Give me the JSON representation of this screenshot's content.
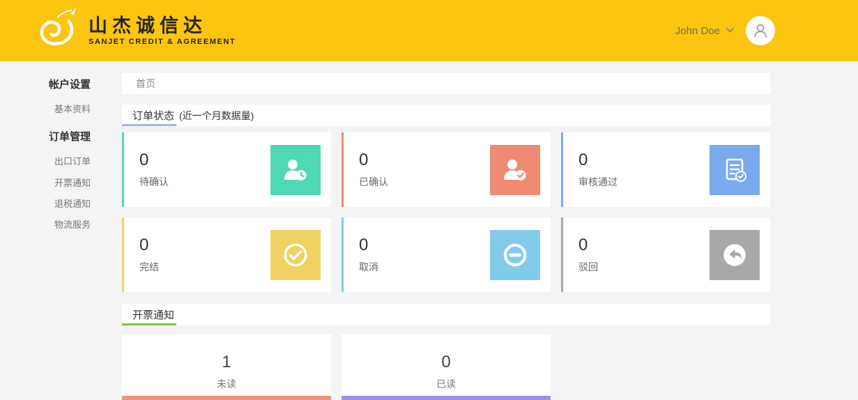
{
  "header": {
    "bg_color": "#fbc510",
    "logo_title": "山杰诚信达",
    "logo_subtitle": "SANJET CREDIT & AGREEMENT",
    "user_name": "John Doe"
  },
  "sidebar": {
    "sections": [
      {
        "label": "帐户设置",
        "items": [
          {
            "label": "基本资料"
          }
        ]
      },
      {
        "label": "订单管理",
        "items": [
          {
            "label": "出口订单"
          },
          {
            "label": "开票通知"
          },
          {
            "label": "退税通知"
          },
          {
            "label": "物流服务"
          }
        ]
      }
    ]
  },
  "breadcrumb": {
    "label": "首页"
  },
  "order_status": {
    "title": "订单状态",
    "subtitle": "(近一个月数据量)",
    "underline_color": "#a9b4f0",
    "cards": [
      {
        "value": "0",
        "label": "待确认",
        "color": "#4fd8b4",
        "icon": "user-clock"
      },
      {
        "value": "0",
        "label": "已确认",
        "color": "#ef8b72",
        "icon": "user-check"
      },
      {
        "value": "0",
        "label": "审核通过",
        "color": "#7aa9ee",
        "icon": "document-check"
      },
      {
        "value": "0",
        "label": "完结",
        "color": "#efd262",
        "icon": "check-circle"
      },
      {
        "value": "0",
        "label": "取消",
        "color": "#82cbe9",
        "icon": "minus-circle"
      },
      {
        "value": "0",
        "label": "驳回",
        "color": "#a8a8a8",
        "icon": "undo-arrow"
      }
    ]
  },
  "invoice_notice": {
    "title": "开票通知",
    "underline_color": "#84c242",
    "cards": [
      {
        "value": "1",
        "label": "未读",
        "border_color": "#f0917d"
      },
      {
        "value": "0",
        "label": "已读",
        "border_color": "#9b8fe8"
      }
    ]
  }
}
